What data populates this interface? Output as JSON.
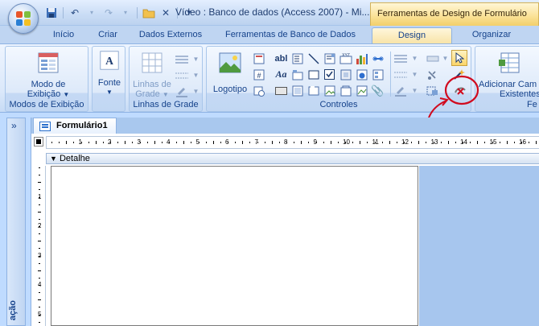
{
  "title_bar": {
    "app_title": "Vídeo : Banco de dados (Access 2007) - Mi...",
    "contextual_title": "Ferramentas de Design de Formulário"
  },
  "quick_access": {
    "icons": [
      "save-icon",
      "undo-icon",
      "redo-icon",
      "open-folder-icon",
      "close-icon",
      "customize-icon"
    ]
  },
  "tabs": [
    "Início",
    "Criar",
    "Dados Externos",
    "Ferramentas de Banco de Dados",
    "Design",
    "Organizar"
  ],
  "active_tab": "Design",
  "ribbon": {
    "groups": {
      "views": {
        "label": "Modos de Exibição",
        "button_line1": "Modo de",
        "button_line2": "Exibição"
      },
      "font": {
        "label": "",
        "button": "Fonte"
      },
      "gridlines": {
        "label": "Linhas de Grade",
        "button_line1": "Linhas de",
        "button_line2": "Grade"
      },
      "controls": {
        "label": "Controles",
        "logo_button": "Logotipo"
      },
      "fields": {
        "label": "Fe",
        "button_line1": "Adicionar Cam",
        "button_line2": "Existentes"
      }
    }
  },
  "document": {
    "tab_title": "Formulário1",
    "section": "Detalhe"
  },
  "nav_pane": {
    "collapse_glyph": "»",
    "label": "ação"
  },
  "ruler": {
    "h_numbers": [
      "1",
      "2",
      "3",
      "4",
      "5",
      "6",
      "7",
      "8",
      "9",
      "10",
      "11",
      "12",
      "13",
      "14",
      "15",
      "16"
    ],
    "v_numbers": [
      "1",
      "2",
      "3",
      "4",
      "5"
    ]
  },
  "colors": {
    "accent": "#15428b",
    "contextual": "#f8e4a8",
    "annotation": "#d10a1e"
  }
}
